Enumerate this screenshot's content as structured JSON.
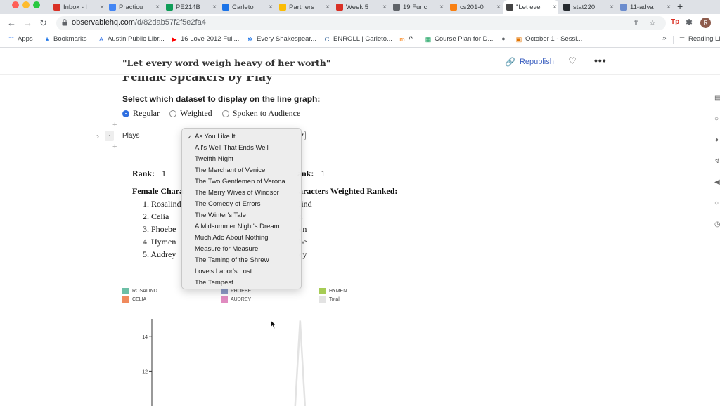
{
  "browser": {
    "tabs": [
      {
        "label": "Inbox - l",
        "icon": "gmail-icon",
        "color": "#d93025",
        "left": 0
      },
      {
        "label": "Practicu",
        "icon": "docs-icon",
        "color": "#4285f4",
        "left": 0
      },
      {
        "label": "PE214B",
        "icon": "sheets-icon",
        "color": "#0f9d58",
        "left": 0
      },
      {
        "label": "Carleto",
        "icon": "doc-icon",
        "color": "#1a73e8",
        "left": 0
      },
      {
        "label": "Partners",
        "icon": "drive-icon",
        "color": "#fbbc04",
        "left": 0
      },
      {
        "label": "Week 5",
        "icon": "word-icon",
        "color": "#d93025",
        "left": 0
      },
      {
        "label": "19 Func",
        "icon": "globe-icon",
        "color": "#5f6368",
        "left": 0
      },
      {
        "label": "cs201-0",
        "icon": "moodle-icon",
        "color": "#f98012",
        "left": 0
      },
      {
        "label": "\"Let eve",
        "icon": "observable-icon",
        "color": "#444",
        "left": 0
      },
      {
        "label": "stat220",
        "icon": "github-icon",
        "color": "#24292e",
        "left": 0
      },
      {
        "label": "11-adva",
        "icon": "r-icon",
        "color": "#6b8cce",
        "left": 0
      }
    ],
    "url_host": "observablehq.com",
    "url_path": "/d/82dab57f2f5e2fa4",
    "profile_initial": "R"
  },
  "bookmarks": [
    {
      "label": "Apps",
      "icon": "apps-grid-icon"
    },
    {
      "label": "Bookmarks",
      "icon": "star-icon"
    },
    {
      "label": "Austin Public Libr...",
      "icon": "library-icon"
    },
    {
      "label": "16 Love 2012 Full...",
      "icon": "youtube-icon"
    },
    {
      "label": "Every Shakespear...",
      "icon": "asterisk-icon"
    },
    {
      "label": "ENROLL | Carleto...",
      "icon": "carleton-icon"
    },
    {
      "label": "/*",
      "icon": "moodle-icon"
    },
    {
      "label": "Course Plan for D...",
      "icon": "sheets-icon"
    },
    {
      "label": "",
      "icon": "globe-icon"
    },
    {
      "label": "October 1 - Sessi...",
      "icon": "calendar-icon"
    }
  ],
  "reading_list": "Reading Li",
  "notebook": {
    "title": "\"Let every word weigh heavy of her worth\"",
    "republish": "Republish"
  },
  "cell": {
    "section_title": "Female Speakers by Play",
    "select_label": "Select which dataset to display on the line graph:",
    "radios": [
      {
        "label": "Regular",
        "checked": true
      },
      {
        "label": "Weighted",
        "checked": false
      },
      {
        "label": "Spoken to Audience",
        "checked": false
      }
    ],
    "plays_label": "Plays",
    "left_rank_label": "Rank:",
    "left_rank_value": "1",
    "right_rank_label": "ank:",
    "right_rank_value": "1",
    "left_list_head": "Female Chara",
    "right_list_head": "aracters Weighted Ranked:",
    "left_list": [
      "1. Rosalind",
      "2. Celia",
      "3. Phoebe",
      "4. Hymen",
      "5. Audrey"
    ],
    "right_list": [
      "lind",
      "a",
      "en",
      "be",
      "ey"
    ]
  },
  "dropdown": {
    "selected": "As You Like It",
    "options": [
      "As You Like It",
      "All's Well That Ends Well",
      "Twelfth Night",
      "The Merchant of Venice",
      "The Two Gentlemen of Verona",
      "The Merry Wives of Windsor",
      "The Comedy of Errors",
      "The Winter's Tale",
      "A Midsummer Night's Dream",
      "Much Ado About Nothing",
      "Measure for Measure",
      "The Taming of the Shrew",
      "Love's Labor's Lost",
      "The Tempest"
    ]
  },
  "chart_data": {
    "type": "line",
    "legend": [
      {
        "name": "ROSALIND",
        "color": "#6dbfa6"
      },
      {
        "name": "CELIA",
        "color": "#f08a5d"
      },
      {
        "name": "PHOEBE",
        "color": "#8e9cc8"
      },
      {
        "name": "AUDREY",
        "color": "#e08bc0"
      },
      {
        "name": "HYMEN",
        "color": "#a6cc55"
      },
      {
        "name": "Total",
        "color": "#e3e3e3"
      }
    ],
    "y_ticks": [
      12,
      14
    ],
    "ylim": [
      10,
      15
    ],
    "visible_peak": {
      "x_fraction": 0.62,
      "y": 14.9
    }
  },
  "colors": {
    "accent": "#3b5fc0",
    "radio_on": "#2f6fe0"
  }
}
